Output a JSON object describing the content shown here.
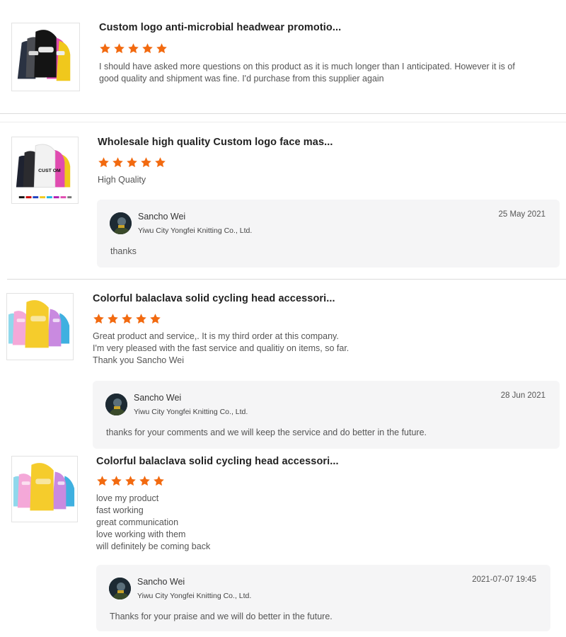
{
  "reviews": [
    {
      "product_title": "Custom logo anti-microbial headwear promotio...",
      "rating": 5,
      "text": "I should have asked more questions on this product as it is much longer than I anticipated.  However it is of\ngood quality and shipment was fine. I'd purchase from this supplier again"
    },
    {
      "product_title": "Wholesale high quality Custom logo face mas...",
      "rating": 5,
      "text": "High Quality",
      "thumb_logo_text": "CUST OM",
      "reply": {
        "name": "Sancho Wei",
        "company": "Yiwu City Yongfei Knitting Co., Ltd.",
        "date": "25 May 2021",
        "text": "thanks"
      }
    },
    {
      "product_title": "Colorful balaclava solid cycling head accessori...",
      "rating": 5,
      "text": "Great product and service,.  It is my third order at this company.\nI'm very pleased with the fast service and qualitiy on items, so far.\nThank you Sancho Wei",
      "reply": {
        "name": "Sancho Wei",
        "company": "Yiwu City Yongfei Knitting Co., Ltd.",
        "date": "28 Jun 2021",
        "text": "thanks for your comments and we will keep the service and do better in the future."
      }
    },
    {
      "product_title": "Colorful balaclava solid cycling head accessori...",
      "rating": 5,
      "text": "love my product\nfast working\ngreat communication\nlove working with them\nwill definitely be coming back",
      "reply": {
        "name": "Sancho Wei",
        "company": "Yiwu City Yongfei Knitting Co., Ltd.",
        "date": "2021-07-07 19:45",
        "text": "Thanks for your praise and we will do better in the future."
      }
    }
  ],
  "colors": {
    "star": "#f26a10",
    "reply_bg": "#f5f5f6",
    "divider": "#dcdcdc"
  },
  "icons": {
    "star": "star-icon",
    "avatar": "avatar-image"
  }
}
